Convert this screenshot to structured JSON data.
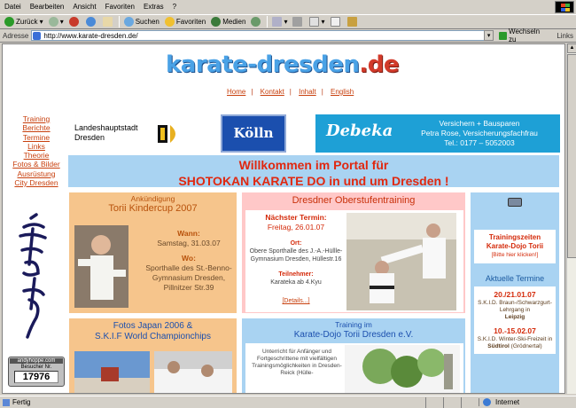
{
  "browser": {
    "menu": [
      "Datei",
      "Bearbeiten",
      "Ansicht",
      "Favoriten",
      "Extras",
      "?"
    ],
    "back": "Zurück",
    "search": "Suchen",
    "favorites": "Favoriten",
    "media": "Medien",
    "address_label": "Adresse",
    "url": "http://www.karate-dresden.de/",
    "go": "Wechseln zu",
    "links": "Links",
    "status_text": "Fertig",
    "zone": "Internet"
  },
  "page": {
    "logo_main": "karate-dresden",
    "logo_tld": ".de",
    "topnav": [
      "Home",
      "Kontakt",
      "Inhalt",
      "English"
    ],
    "sidenav": [
      "Training",
      "Berichte",
      "Termine",
      "Links",
      "Theorie",
      "Fotos & Bilder",
      "Ausrüstung",
      "City Dresden"
    ],
    "counter": {
      "site": "andyhoppe.com",
      "label": "Besucher Nr.",
      "value": "17976"
    },
    "banner1": {
      "line1": "Landeshauptstadt",
      "line2": "Dresden"
    },
    "banner2": "Kölln",
    "banner3": {
      "brand": "Debeka",
      "l1": "Versichern + Bausparen",
      "l2": "Petra Rose, Versicherungsfachfrau",
      "l3": "Tel.: 0177 – 5052003"
    },
    "welcome": {
      "l1": "Willkommen im Portal für",
      "l2": "SHOTOKAN KARATE DO in und um Dresden !"
    },
    "p1": {
      "hd": "Ankündigung",
      "title": "Torii Kindercup 2007",
      "wann": "Wann:",
      "date": "Samstag, 31.03.07",
      "wo": "Wo:",
      "place": "Sporthalle des St.-Benno-Gymnasium Dresden, Pillnitzer Str.39"
    },
    "p2": {
      "hd": "Dresdner Oberstufentraining",
      "next": "Nächster Termin:",
      "date": "Freitag, 26.01.07",
      "ort": "Ort:",
      "place": "Obere Sporthalle des J.-A.-Hüllle-Gymnasium Dresden, Hüllestr.16",
      "tn": "Teilnehmer:",
      "who": "Karateka ab 4.Kyu",
      "details": "[Details...]"
    },
    "p3": {
      "box1a": "Trainingszeiten",
      "box1b": "Karate-Dojo Torii",
      "box1c": "[Bitte hier klicken!]",
      "at": "Aktuelle Termine",
      "d1": "20./21.01.07",
      "t1": "S.K.I.D. Braun-/Schwarzgurt-Lehrgang in",
      "t1b": "Leipzig",
      "d2": "10.-15.02.07",
      "t2": "S.K.I.D. Winter-Ski-Freizeit in",
      "t2b": "Südtirol",
      "t2c": "(Grödnertal)"
    },
    "p4": {
      "l1": "Fotos Japan 2006 &",
      "l2": "S.K.I.F World Championchips"
    },
    "p5": {
      "hd": "Training im",
      "title": "Karate-Dojo Torii Dresden e.V.",
      "txt": "Unterricht für Anfänger und Fortgeschrittene mit vielfältigen Trainingsmöglichkeiten in Dresden-Reick (Hülle-"
    }
  }
}
